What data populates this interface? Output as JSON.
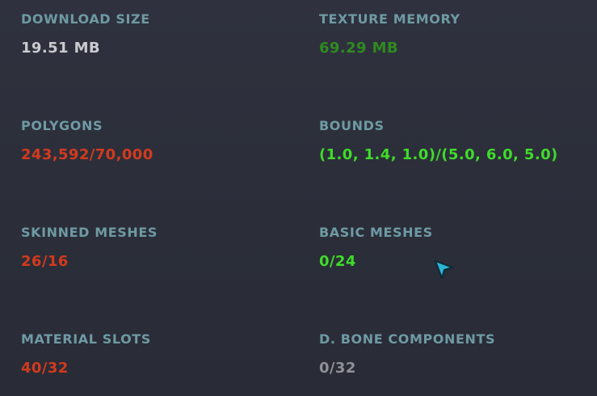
{
  "stats": {
    "download_size": {
      "label": "DOWNLOAD SIZE",
      "value": "19.51 MB",
      "color": "#c9cbd0"
    },
    "texture_memory": {
      "label": "TEXTURE MEMORY",
      "value": "69.29 MB",
      "color": "#2f8a1f"
    },
    "polygons": {
      "label": "POLYGONS",
      "value": "243,592/70,000",
      "color": "#d23a1e"
    },
    "bounds": {
      "label": "BOUNDS",
      "value": "(1.0, 1.4, 1.0)/(5.0, 6.0, 5.0)",
      "color": "#3fdc2a"
    },
    "skinned_meshes": {
      "label": "SKINNED MESHES",
      "value": "26/16",
      "color": "#d23a1e"
    },
    "basic_meshes": {
      "label": "BASIC MESHES",
      "value": "0/24",
      "color": "#3fdc2a"
    },
    "material_slots": {
      "label": "MATERIAL SLOTS",
      "value": "40/32",
      "color": "#d23a1e"
    },
    "dynamic_bone_components": {
      "label": "D. BONE COMPONENTS",
      "value": "0/32",
      "color": "#8f9197"
    }
  },
  "cursor": {
    "icon": "pointer-cursor-icon",
    "color": "#2bb6d6"
  }
}
